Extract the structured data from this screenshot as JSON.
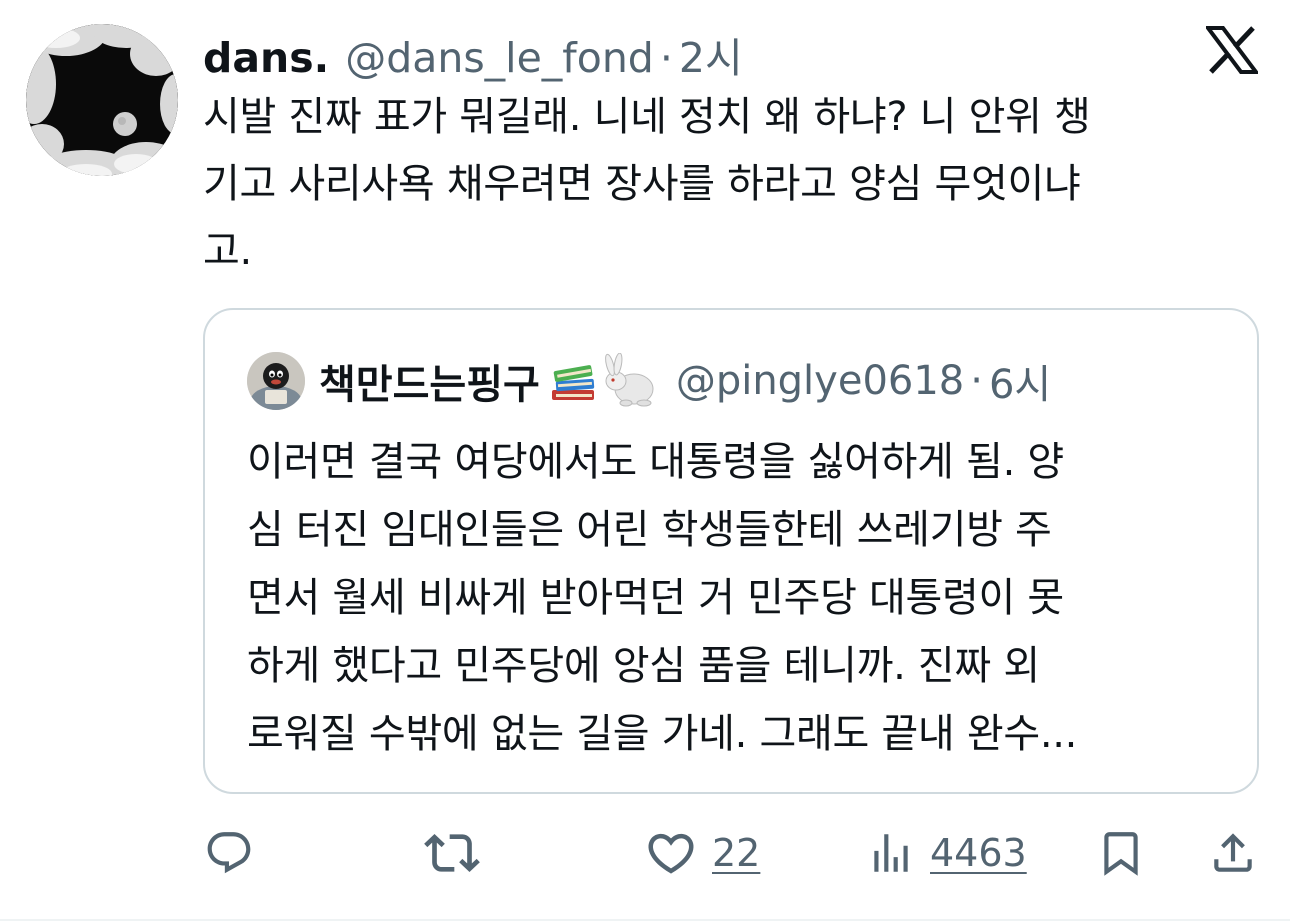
{
  "tweet": {
    "display_name": "dans.",
    "handle": "@dans_le_fond",
    "separator": "·",
    "time": "2시",
    "text_lines": [
      "시발 진짜 표가 뭐길래. 니네 정치 왜 하냐? 니 안위 챙",
      "기고 사리사욕 채우려면 장사를 하라고 양심 무엇이냐",
      "고."
    ]
  },
  "quote": {
    "display_name": "책만드는핑구",
    "name_emojis": "📚🐇",
    "handle": "@pinglye0618",
    "separator": "·",
    "time": "6시",
    "text_lines": [
      "이러면 결국 여당에서도 대통령을 싫어하게 됨. 양",
      "심 터진 임대인들은 어린 학생들한테 쓰레기방 주",
      "면서 월세 비싸게 받아먹던 거 민주당 대통령이 못",
      "하게 했다고 민주당에 앙심 품을 테니까. 진짜 외",
      "로워질 수밖에 없는 길을 가네. 그래도 끝내 완수..."
    ]
  },
  "actions": {
    "reply_icon": "reply-icon",
    "retweet_icon": "retweet-icon",
    "like_icon": "heart-icon",
    "like_count": "22",
    "views_icon": "views-icon",
    "views_count": "4463",
    "bookmark_icon": "bookmark-icon",
    "share_icon": "share-icon"
  },
  "colors": {
    "text": "#0f1419",
    "secondary": "#536471",
    "border": "#cfd9de"
  }
}
